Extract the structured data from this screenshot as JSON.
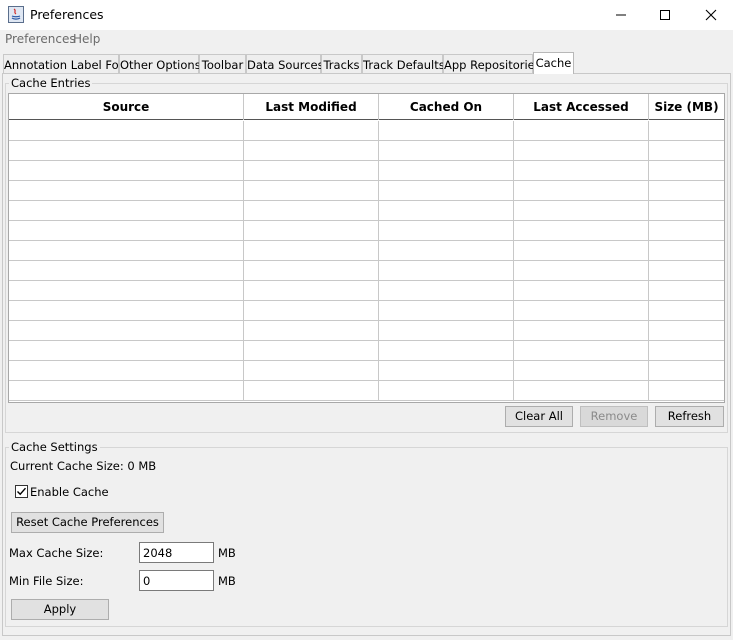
{
  "window": {
    "title": "Preferences"
  },
  "menu": [
    "Preferences",
    "Help"
  ],
  "tabs": [
    "Annotation Label Font",
    "Other Options",
    "Toolbar",
    "Data Sources",
    "Tracks",
    "Track Defaults",
    "App Repositories",
    "Cache"
  ],
  "active_tab": "Cache",
  "cache_entries": {
    "title": "Cache Entries",
    "columns": [
      "Source",
      "Last Modified",
      "Cached On",
      "Last Accessed",
      "Size (MB)"
    ],
    "rows": [],
    "buttons": {
      "clear_all": "Clear All",
      "remove": "Remove",
      "refresh": "Refresh"
    }
  },
  "cache_settings": {
    "title": "Cache Settings",
    "current_size": "Current Cache Size: 0 MB",
    "enable_label": "Enable Cache",
    "enable_checked": true,
    "reset_label": "Reset Cache Preferences",
    "max_label": "Max Cache Size:",
    "max_value": "2048",
    "max_unit": "MB",
    "min_label": "Min File Size:",
    "min_value": "0",
    "min_unit": "MB",
    "apply_label": "Apply"
  }
}
